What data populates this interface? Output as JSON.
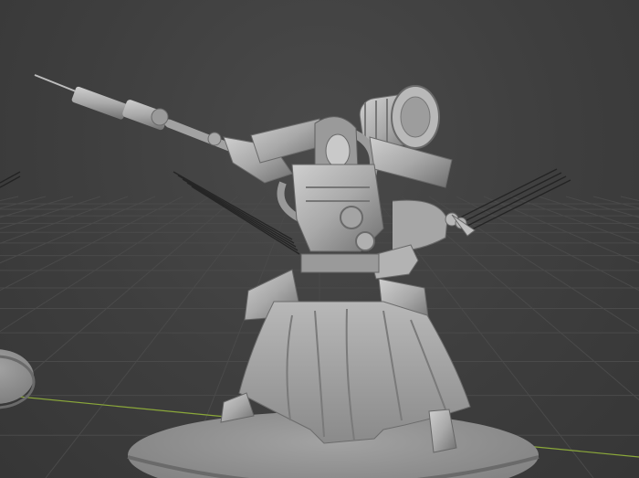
{
  "viewport": {
    "background_color": "#3d3d3d",
    "grid_color": "#4a4a4a",
    "x_axis_color": "#8ba83a"
  },
  "scene": {
    "objects": [
      {
        "name": "robed-mechanical-figure-model",
        "color": "#a8a8a8"
      },
      {
        "name": "round-base-main",
        "color": "#8f8f8f"
      },
      {
        "name": "round-base-left",
        "color": "#8a8a8a"
      }
    ]
  }
}
